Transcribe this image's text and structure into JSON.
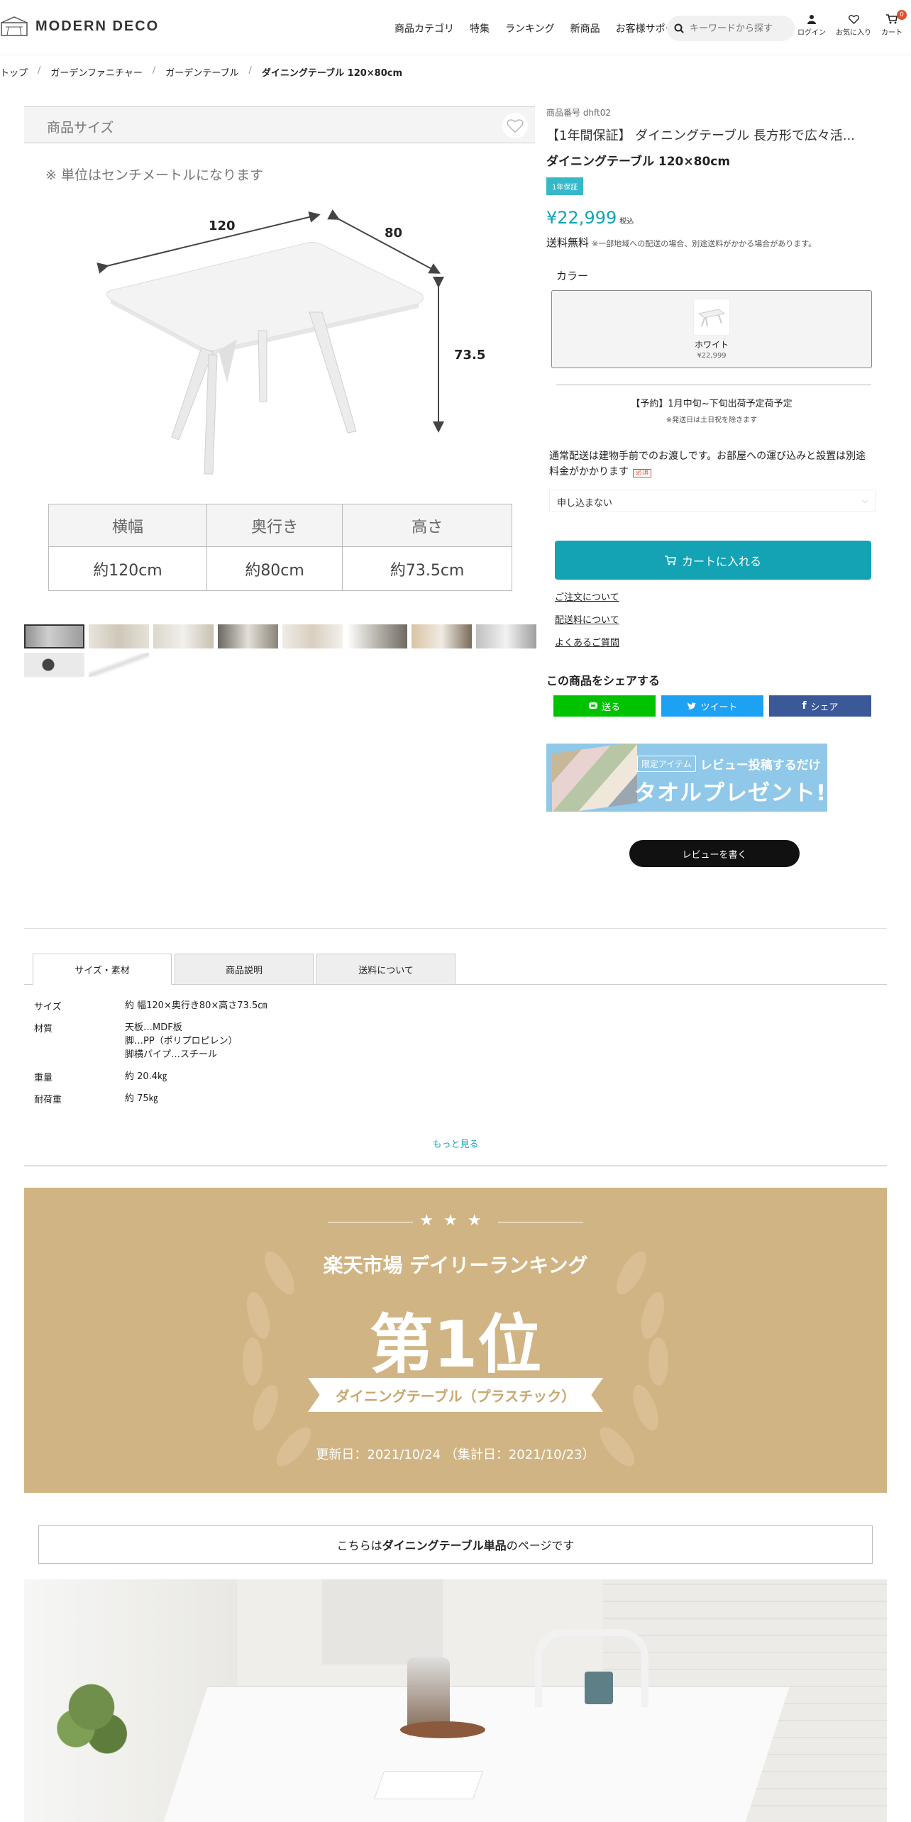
{
  "header": {
    "logo": "MODERN DECO",
    "nav": [
      "商品カテゴリ",
      "特集",
      "ランキング",
      "新商品",
      "お客様サポート"
    ],
    "search_placeholder": "キーワードから探す",
    "icons": [
      {
        "name": "user-icon",
        "label": "ログイン"
      },
      {
        "name": "heart-icon",
        "label": "お気に入り"
      },
      {
        "name": "cart-icon",
        "label": "カート"
      }
    ],
    "cart_count": "0"
  },
  "breadcrumb": [
    "トップ",
    "ガーデンファニチャー",
    "ガーデンテーブル",
    "ダイニングテーブル 120×80cm"
  ],
  "image": {
    "header_label": "商品サイズ",
    "note": "※ 単位はセンチメートルになります",
    "dim_labels": [
      "120",
      "80",
      "73.5"
    ],
    "table_headers": [
      "横幅",
      "奥行き",
      "高さ"
    ],
    "table_values": [
      "約120cm",
      "約80cm",
      "約73.5cm"
    ]
  },
  "product": {
    "sku": "商品番号 dhft02",
    "title": "【1年間保証】 ダイニングテーブル 長方形で広々活...",
    "subtitle": "ダイニングテーブル 120×80cm",
    "warranty_badge": "1年保証",
    "price": "¥22,999",
    "tax_label": "税込",
    "shipping": "送料無料",
    "shipping_note": "※一部地域への配送の場合、別途送料がかかる場合があります。",
    "color_label": "カラー",
    "swatch_name": "ホワイト",
    "swatch_price": "¥22,999",
    "reserve": "【予約】1月中旬~下旬出荷予定荷予定",
    "reserve_note": "※発送日は土日祝を除きます",
    "delivery_text": "通常配送は建物手前でのお渡しです。お部屋への運び込みと設置は別途料金がかかります",
    "required_label": "必須",
    "select_value": "申し込まない",
    "cart_button": "カートに入れる",
    "links": [
      "ご注文について",
      "配送料について",
      "よくあるご質問"
    ],
    "share_title": "この商品をシェアする",
    "share_buttons": [
      "送る",
      "ツイート",
      "シェア"
    ],
    "banner_tag": "限定アイテム",
    "banner_line1": "レビュー投稿するだけ",
    "banner_line2": "タオルプレゼント!",
    "review_button": "レビューを書く"
  },
  "tabs": [
    "サイズ・素材",
    "商品説明",
    "送料について"
  ],
  "specs": [
    {
      "k": "サイズ",
      "v": [
        "約 幅120×奥行き80×高さ73.5㎝"
      ]
    },
    {
      "k": "材質",
      "v": [
        "天板…MDF板",
        "脚…PP（ポリプロピレン）",
        "脚横パイプ…スチール"
      ]
    },
    {
      "k": "重量",
      "v": [
        "約 20.4㎏"
      ]
    },
    {
      "k": "耐荷重",
      "v": [
        "約 75㎏"
      ]
    }
  ],
  "more_label": "もっと見る",
  "ranking": {
    "stars": "★★★",
    "title": "楽天市場 デイリーランキング",
    "big": "第1位",
    "ribbon": "ダイニングテーブル（プラスチック）",
    "date": "更新日：2021/10/24 （集計日：2021/10/23）"
  },
  "notice": {
    "pre": "こちらは",
    "bold": "ダイニングテーブル単品",
    "post": "のページです"
  },
  "colors": {
    "accent": "#14a3b5",
    "rank_bg": "#d1b483",
    "line": "#00c300",
    "twitter": "#1da1f2",
    "facebook": "#3b5998"
  }
}
